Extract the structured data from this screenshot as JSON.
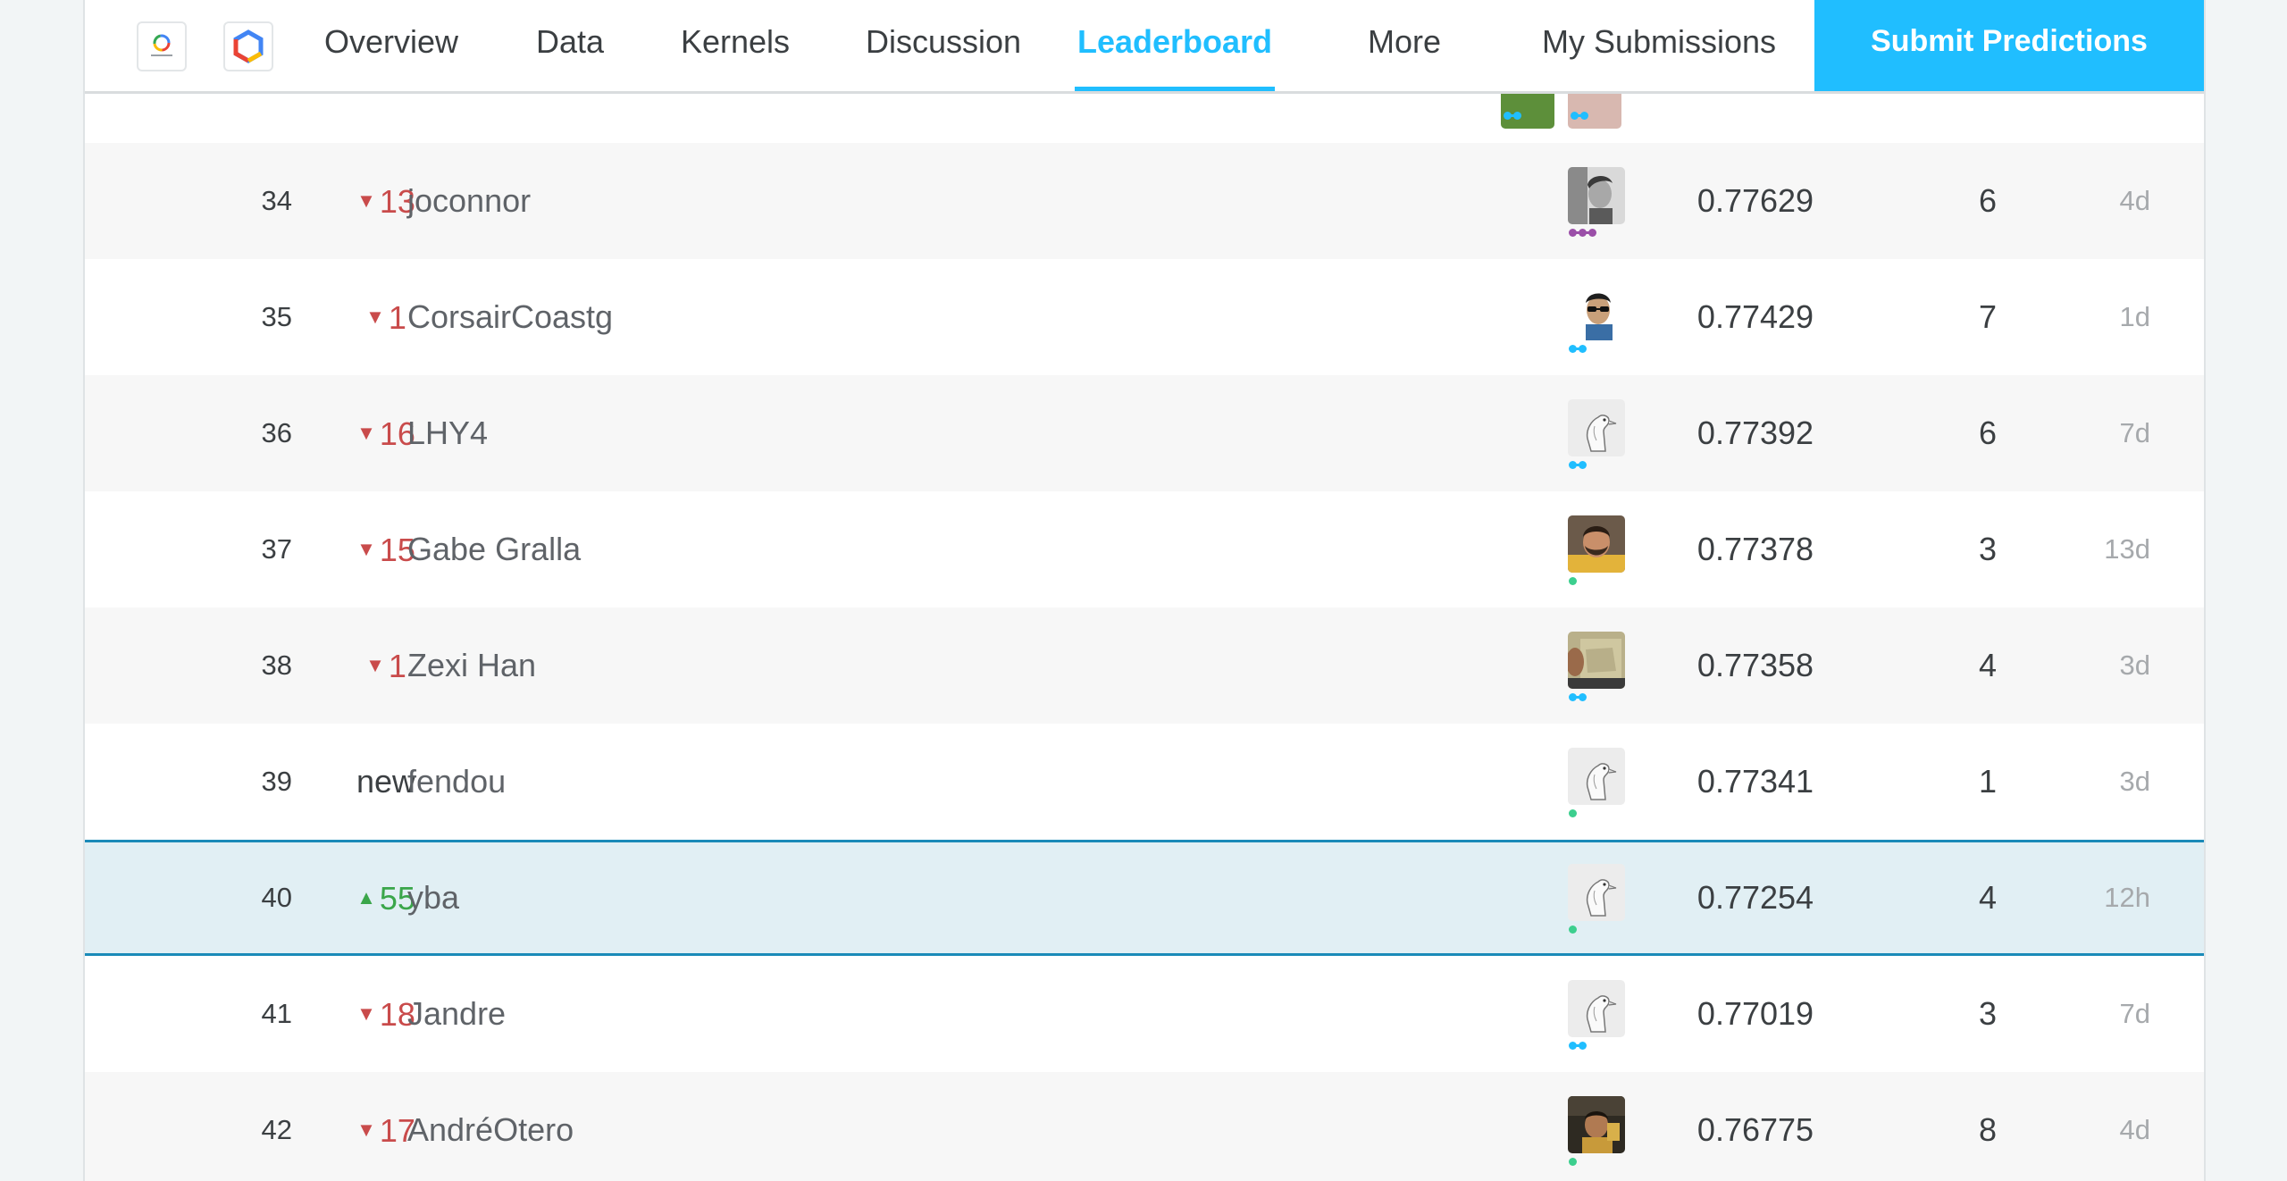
{
  "nav": {
    "logos": [
      {
        "name": "google-cloud-platform-logo",
        "label": "Google Cloud Platform"
      },
      {
        "name": "google-cloud-hexagon-logo"
      }
    ],
    "tabs": [
      {
        "label": "Overview",
        "active": false
      },
      {
        "label": "Data",
        "active": false
      },
      {
        "label": "Kernels",
        "active": false
      },
      {
        "label": "Discussion",
        "active": false
      },
      {
        "label": "Leaderboard",
        "active": true
      },
      {
        "label": "More",
        "active": false
      },
      {
        "label": "My Submissions",
        "active": false
      }
    ],
    "submit_label": "Submit Predictions"
  },
  "colors": {
    "accent": "#20beff",
    "down": "#c94b4b",
    "up": "#3aa64a",
    "highlight_bg": "#e1eff4",
    "highlight_border": "#1a8ab8",
    "tier_contributor": "#20beff",
    "tier_novice": "#3ccf8e",
    "tier_expert": "#9b4fa8"
  },
  "leaderboard": {
    "rows": [
      {
        "rank": "34",
        "change_dir": "down",
        "change": "13",
        "team": "joconnor",
        "avatar": "photo-man-curly-hair-icon",
        "tier": "expert",
        "score": "0.77629",
        "entries": "6",
        "last": "4d"
      },
      {
        "rank": "35",
        "change_dir": "down",
        "change": "1",
        "team": "CorsairCoastg",
        "avatar": "photo-man-glasses-icon",
        "tier": "contributor",
        "score": "0.77429",
        "entries": "7",
        "last": "1d"
      },
      {
        "rank": "36",
        "change_dir": "down",
        "change": "16",
        "team": "LHY4",
        "avatar": "default-goose-icon",
        "tier": "contributor",
        "score": "0.77392",
        "entries": "6",
        "last": "7d"
      },
      {
        "rank": "37",
        "change_dir": "down",
        "change": "15",
        "team": "Gabe Gralla",
        "avatar": "photo-man-beard-icon",
        "tier": "novice",
        "score": "0.77378",
        "entries": "3",
        "last": "13d"
      },
      {
        "rank": "38",
        "change_dir": "down",
        "change": "1",
        "team": "Zexi Han",
        "avatar": "photo-person-map-icon",
        "tier": "contributor",
        "score": "0.77358",
        "entries": "4",
        "last": "3d"
      },
      {
        "rank": "39",
        "change_dir": "new",
        "change": "new",
        "team": "fendou",
        "avatar": "default-goose-icon",
        "tier": "novice",
        "score": "0.77341",
        "entries": "1",
        "last": "3d"
      },
      {
        "rank": "40",
        "change_dir": "up",
        "change": "55",
        "team": "yba",
        "avatar": "default-goose-icon",
        "tier": "novice",
        "score": "0.77254",
        "entries": "4",
        "last": "12h",
        "highlight": true
      },
      {
        "rank": "41",
        "change_dir": "down",
        "change": "18",
        "team": "Jandre",
        "avatar": "default-goose-icon",
        "tier": "contributor",
        "score": "0.77019",
        "entries": "3",
        "last": "7d"
      },
      {
        "rank": "42",
        "change_dir": "down",
        "change": "17",
        "team": "AndréOtero",
        "avatar": "photo-man-dark-icon",
        "tier": "novice",
        "score": "0.76775",
        "entries": "8",
        "last": "4d"
      }
    ]
  }
}
